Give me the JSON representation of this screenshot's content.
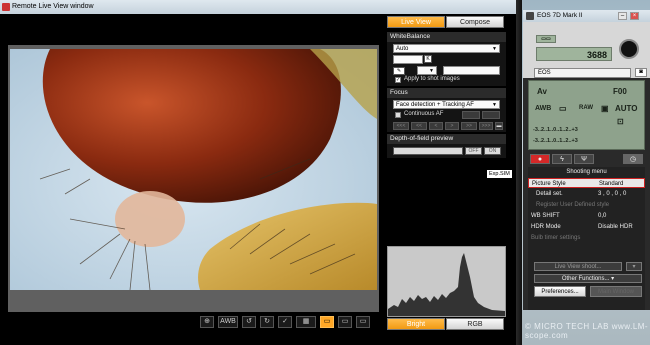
{
  "rlv": {
    "title": "Remote Live View window",
    "tabs": {
      "live_view": "Live View",
      "compose": "Compose"
    },
    "white_balance": {
      "title": "WhiteBalance",
      "mode": "Auto",
      "k_label": "K",
      "apply_label": "Apply to shot images",
      "apply_checked": true
    },
    "focus": {
      "title": "Focus",
      "mode": "Face detection + Tracking AF",
      "continuous_label": "Continuous AF",
      "continuous_checked": false,
      "steps": [
        "<<<",
        "<<",
        "<",
        ">",
        ">>",
        ">>>"
      ]
    },
    "dof": {
      "title": "Depth-of-field preview",
      "off_label": "OFF",
      "on_label": "ON"
    },
    "ep_button": "Exp.SIM",
    "histogram": {
      "bright_label": "Bright",
      "rgb_label": "RGB"
    },
    "toolbar": {
      "zoom": "⊕",
      "awb": "AWB",
      "rot_left": "↺",
      "rot_right": "↻",
      "check": "✓",
      "grid": "▦"
    }
  },
  "eos": {
    "title": "EOS 7D Mark II",
    "win_buttons": {
      "min": "–",
      "max": "□",
      "close": "×"
    },
    "shots": "3688",
    "lcd_left": "▭▭",
    "model_field": "EOS",
    "settings": {
      "mode": "Av",
      "aperture": "F00",
      "wb": "AWB",
      "drive": "▭",
      "quality": "RAW",
      "af": "▣",
      "iso": "AUTO",
      "metering": "⊡",
      "exposure_scale": "-3..2..1..0..1..2..+3",
      "bracket_scale": "-3..2..1..0..1..2..+3"
    },
    "tabs": [
      "●",
      "ϟ",
      "Ψ"
    ],
    "timer_icon": "◷",
    "menu_title": "Shooting menu",
    "menu": [
      {
        "label": "Picture Style",
        "value": "Standard",
        "highlight": true
      },
      {
        "label": "Detail set.",
        "value": "3 , 0 , 0 , 0"
      },
      {
        "label": "Register User Defined style",
        "value": "",
        "disabled": true
      },
      {
        "label": "WB SHIFT",
        "value": "0,0"
      },
      {
        "label": "HDR Mode",
        "value": "Disable HDR"
      },
      {
        "label": "Bulb timer settings",
        "value": "",
        "disabled": true
      }
    ],
    "live_view_shoot": "Live View shoot...",
    "other_functions": "Other Functions...",
    "preferences": "Preferences...",
    "main_window": "Main Window"
  },
  "watermark": "© MICRO TECH LAB  www.LM-scope.com",
  "colors": {
    "accent_orange": "#f29a13",
    "camera_red": "#d42828",
    "lcd_green": "#9fb49c"
  },
  "icons": {
    "viewer_zoom": "zoom-icon",
    "eos_dial": "dial-icon",
    "histogram": "histogram-icon"
  }
}
